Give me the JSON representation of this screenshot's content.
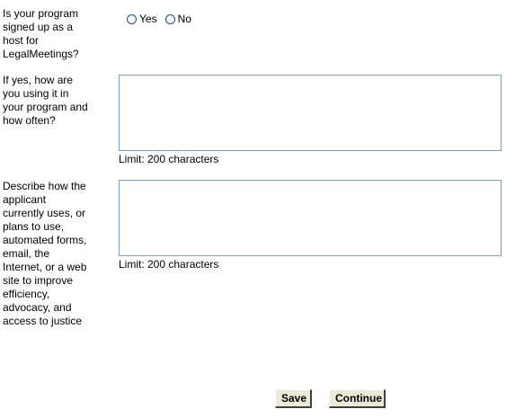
{
  "form": {
    "q1": {
      "label": "Is your program signed up as a host for LegalMeetings?",
      "options": [
        "Yes",
        "No"
      ]
    },
    "q2": {
      "label": "If yes, how are you using it in your program and how often?",
      "value": "",
      "limit_text": "Limit: 200 characters"
    },
    "q3": {
      "label": "Describe how the applicant currently uses, or plans to use, automated forms, email, the Internet, or a web site to improve efficiency, advocacy, and access to justice",
      "value": "",
      "limit_text": "Limit: 200 characters"
    }
  },
  "buttons": {
    "save_label": "Save",
    "continue_label": "Continue"
  },
  "colors": {
    "radio_border": "#1c5180",
    "textarea_border": "#7f9db9",
    "button_face": "#ece9d8"
  }
}
